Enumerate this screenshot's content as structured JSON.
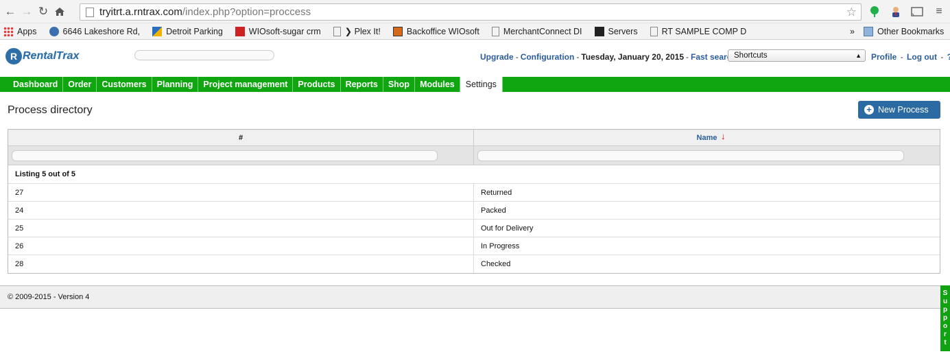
{
  "browser": {
    "url_host": "tryitrt.a.rntrax.com",
    "url_path": "/index.php?option=proccess",
    "bookmarks": [
      {
        "label": "Apps",
        "icon": "apps-grid-icon"
      },
      {
        "label": "6646 Lakeshore Rd,",
        "icon": "globe-icon"
      },
      {
        "label": "Detroit Parking",
        "icon": "parking-icon"
      },
      {
        "label": "WIOsoft-sugar crm",
        "icon": "sugarcrm-icon"
      },
      {
        "label": "❯ Plex It!",
        "icon": "page-icon"
      },
      {
        "label": "Backoffice WIOsoft",
        "icon": "backoffice-icon"
      },
      {
        "label": "MerchantConnect DI",
        "icon": "page-icon"
      },
      {
        "label": "Servers",
        "icon": "plex-icon"
      },
      {
        "label": "RT SAMPLE COMP D",
        "icon": "page-icon"
      }
    ],
    "overflow": "»",
    "other_bookmarks": "Other Bookmarks"
  },
  "header": {
    "logo_text": "RentalTrax",
    "logo_mark": "R",
    "upgrade": "Upgrade",
    "configuration": "Configuration",
    "date": "Tuesday, January 20, 2015",
    "fast_search": "Fast search",
    "shortcuts": "Shortcuts",
    "profile": "Profile",
    "logout": "Log out",
    "help": "?"
  },
  "nav": {
    "items": [
      "Dashboard",
      "Order",
      "Customers",
      "Planning",
      "Project management",
      "Products",
      "Reports",
      "Shop",
      "Modules",
      "Settings"
    ],
    "active": "Settings"
  },
  "page": {
    "title": "Process directory",
    "new_button": "New Process"
  },
  "grid": {
    "columns": [
      "#",
      "Name"
    ],
    "sort_indicator": "↓",
    "listing": "Listing 5 out of 5",
    "rows": [
      {
        "id": "27",
        "name": "Returned"
      },
      {
        "id": "24",
        "name": "Packed"
      },
      {
        "id": "25",
        "name": "Out for Delivery"
      },
      {
        "id": "26",
        "name": "In Progress"
      },
      {
        "id": "28",
        "name": "Checked"
      }
    ]
  },
  "footer": {
    "text": "© 2009-2015 - Version 4",
    "support": "Support"
  },
  "colors": {
    "nav_green": "#0fa60f",
    "link_blue": "#2a5d9a",
    "button_blue": "#2c6aa3"
  }
}
